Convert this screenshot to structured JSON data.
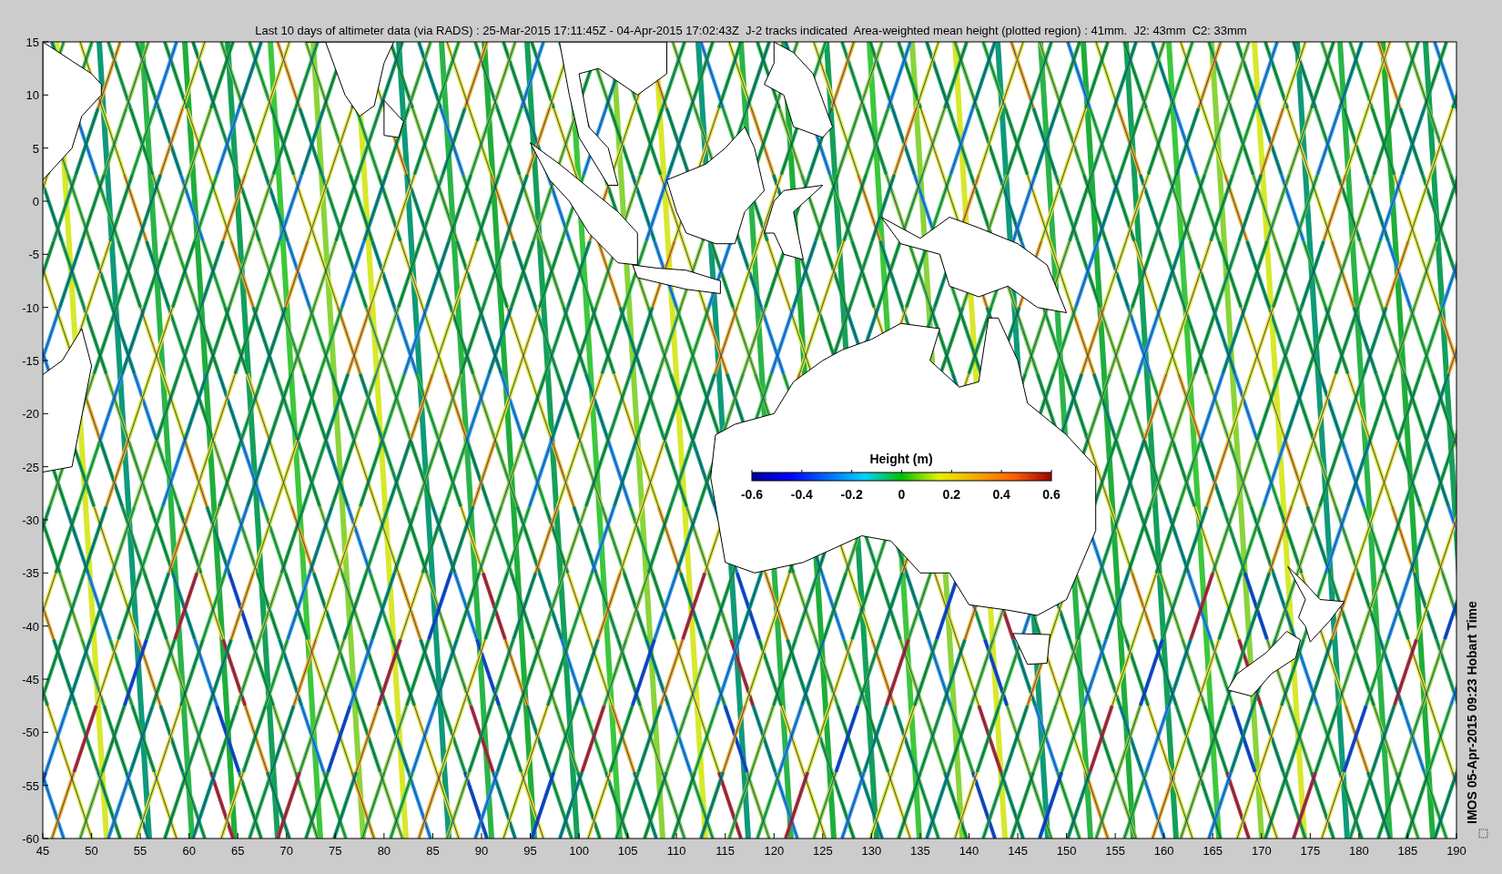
{
  "title": "Last 10 days of altimeter data (via RADS) : 25-Mar-2015 17:11:45Z - 04-Apr-2015 17:02:43Z  J-2 tracks indicated  Area-weighted mean height (plotted region) : 41mm.  J2: 43mm  C2: 33mm",
  "y_ticks": [
    "15",
    "10",
    "5",
    "0",
    "-5",
    "-10",
    "-15",
    "-20",
    "-25",
    "-30",
    "-35",
    "-40",
    "-45",
    "-50",
    "-55",
    "-60"
  ],
  "x_ticks": [
    "45",
    "50",
    "55",
    "60",
    "65",
    "70",
    "75",
    "80",
    "85",
    "90",
    "95",
    "100",
    "105",
    "110",
    "115",
    "120",
    "125",
    "130",
    "135",
    "140",
    "145",
    "150",
    "155",
    "160",
    "165",
    "170",
    "175",
    "180",
    "185",
    "190"
  ],
  "colorbar": {
    "title": "Height (m)",
    "ticks": [
      "-0.6",
      "-0.4",
      "-0.2",
      "0",
      "0.2",
      "0.4",
      "0.6"
    ]
  },
  "timestamp": "IMOS 05-Apr-2015 09:23 Hobart Time"
}
